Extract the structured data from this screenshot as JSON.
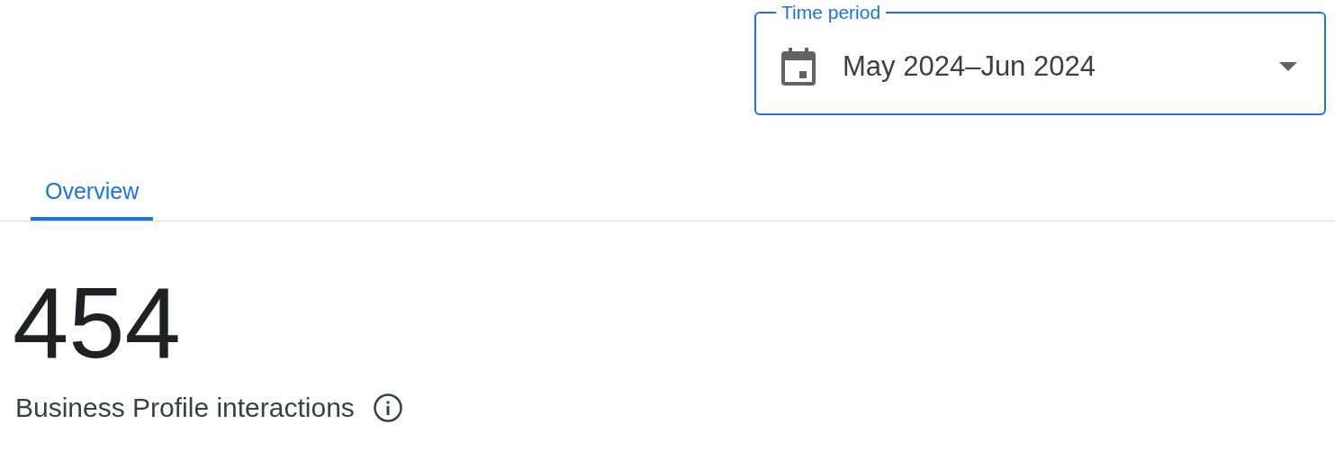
{
  "time_period": {
    "label": "Time period",
    "value": "May 2024–Jun 2024"
  },
  "tabs": [
    {
      "label": "Overview",
      "selected": true
    }
  ],
  "metric": {
    "value": "454",
    "label": "Business Profile interactions"
  }
}
